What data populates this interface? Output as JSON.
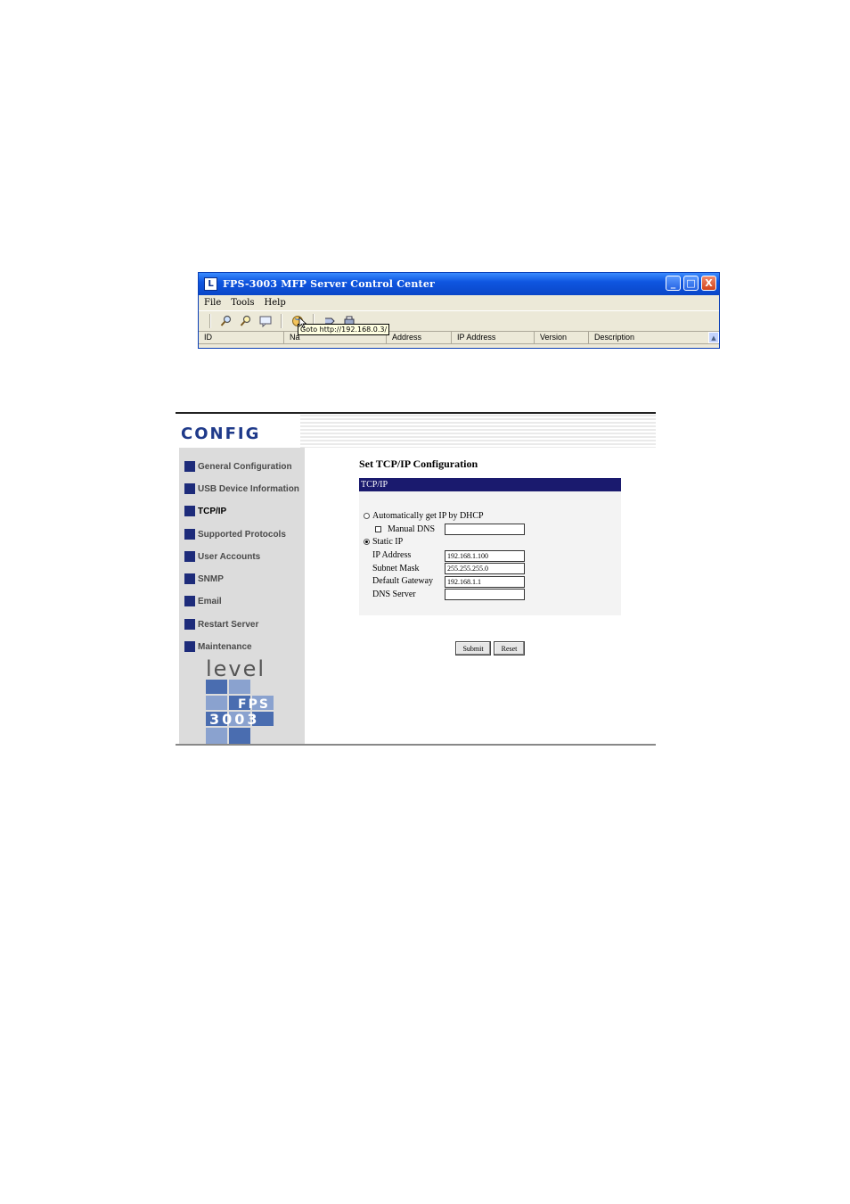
{
  "control_center": {
    "title": "FPS-3003 MFP Server Control Center",
    "app_icon": "L",
    "window_buttons": {
      "minimize": "_",
      "maximize": "□",
      "close": "X"
    },
    "menu": [
      "File",
      "Tools",
      "Help"
    ],
    "toolbar_icons": [
      "search-icon",
      "find-ip-icon",
      "message-icon",
      "goto-web-icon",
      "upgrade-icon",
      "printer-icon"
    ],
    "tooltip": "Goto http://192.168.0.3/",
    "columns": [
      "ID",
      "Na",
      "Address",
      "IP Address",
      "Version",
      "Description"
    ]
  },
  "config": {
    "logo": "CONFIG",
    "nav": [
      "General Configuration",
      "USB Device Information",
      "TCP/IP",
      "Supported Protocols",
      "User Accounts",
      "SNMP",
      "Email",
      "Restart Server",
      "Maintenance"
    ],
    "active_nav": "TCP/IP",
    "brand": {
      "word": "level",
      "line1": "FPS",
      "line2": "3003"
    },
    "page_title": "Set TCP/IP Configuration",
    "box_header": "TCP/IP",
    "dhcp_option": "Automatically  get IP by DHCP",
    "manual_dns": "Manual DNS",
    "manual_dns_value": "",
    "static_option": "Static IP",
    "ip_label": "IP Address",
    "ip_value": "192.168.1.100",
    "mask_label": "Subnet Mask",
    "mask_value": "255.255.255.0",
    "gateway_label": "Default Gateway",
    "gateway_value": "192.168.1.1",
    "dns_label": "DNS Server",
    "dns_value": "",
    "submit": "Submit",
    "reset": "Reset"
  }
}
